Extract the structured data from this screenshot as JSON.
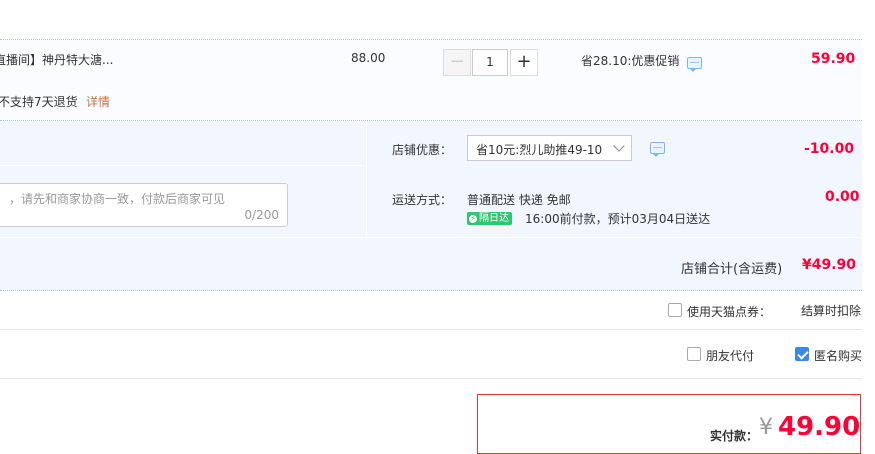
{
  "item": {
    "title": "直播间】神丹特大溏...",
    "unit_price": "88.00",
    "quantity": "1",
    "promo_text": "省28.10:优惠促销",
    "subtotal": "59.90",
    "return_policy": "不支持7天退货",
    "details_link": "详情",
    "minus_label": "−",
    "plus_label": "+"
  },
  "shop": {
    "discount_label": "店铺优惠：",
    "discount_selected": "省10元:烈儿助推49-10",
    "discount_amount": "-10.00",
    "shipping_label": "运送方式：",
    "shipping_method": "普通配送 快递 免邮",
    "shipping_fee": "0.00",
    "next_day_badge": "隔日达",
    "delivery_note": "16:00前付款，预计03月04日送达",
    "message_placeholder": "，请先和商家协商一致，付款后商家可见",
    "message_count": "0/200",
    "total_label": "店铺合计(含运费)",
    "total_value": "¥49.90"
  },
  "options": {
    "tmall_points_label": "使用天猫点券：",
    "tmall_points_value": "结算时扣除",
    "friend_pay_label": "朋友代付",
    "anonymous_label": "匿名购买",
    "anonymous_checked": true
  },
  "payment": {
    "label": "实付款：",
    "currency": "¥",
    "amount": "49.90"
  },
  "colors": {
    "accent_red": "#ff0036",
    "link_orange": "#c8703f",
    "badge_green": "#2ec76f",
    "checkbox_blue": "#3b86e6"
  },
  "icons": [
    "chat-icon",
    "check-icon",
    "lightning-icon",
    "chevron-down-icon"
  ]
}
